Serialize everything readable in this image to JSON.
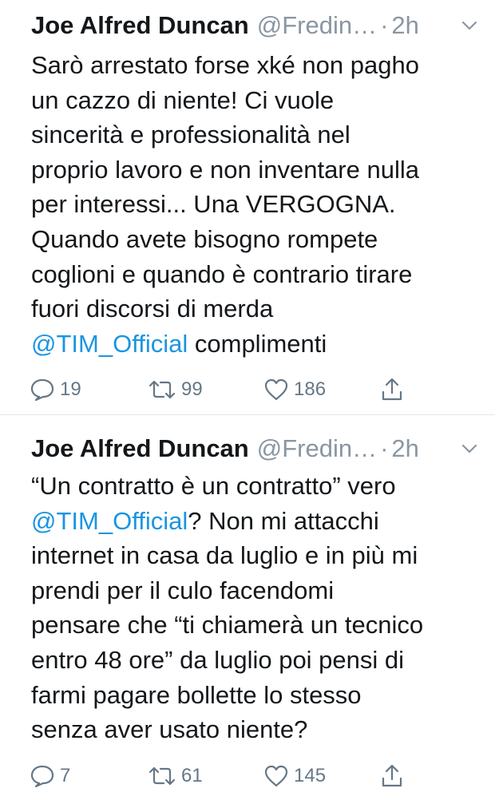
{
  "tweets": [
    {
      "name": "Joe Alfred Duncan",
      "handle": "@Fredin…",
      "separator": "·",
      "time": "2h",
      "lines": [
        "Sarò arrestato forse xké non pagho",
        "un cazzo di niente! Ci vuole",
        "sincerità e professionalità nel",
        "proprio lavoro e non inventare nulla",
        "per interessi... Una VERGOGNA.",
        "Quando avete bisogno rompete",
        "coglioni e quando è contrario tirare",
        "fuori discorsi di merda"
      ],
      "last_mention": "@TIM_Official",
      "last_text": " complimenti",
      "replies": "19",
      "retweets": "99",
      "likes": "186"
    },
    {
      "name": "Joe Alfred Duncan",
      "handle": "@Fredin…",
      "separator": "·",
      "time": "2h",
      "first_line": "“Un contratto è un contratto” vero",
      "mention": "@TIM_Official",
      "after_mention": "? Non mi attacchi",
      "lines": [
        "internet in casa da luglio e in più mi",
        "prendi per il culo facendomi",
        "pensare che “ti chiamerà un tecnico",
        "entro 48 ore” da luglio poi pensi di",
        "farmi pagare bollette lo stesso",
        "senza aver usato niente?"
      ],
      "replies": "7",
      "retweets": "61",
      "likes": "145"
    }
  ],
  "colors": {
    "text": "#14171a",
    "meta": "#8a96a3",
    "link": "#1b95e0",
    "action": "#657786",
    "divider": "#e1e8ed"
  },
  "icons": [
    "reply-icon",
    "retweet-icon",
    "like-icon",
    "share-icon",
    "chevron-down-icon"
  ]
}
